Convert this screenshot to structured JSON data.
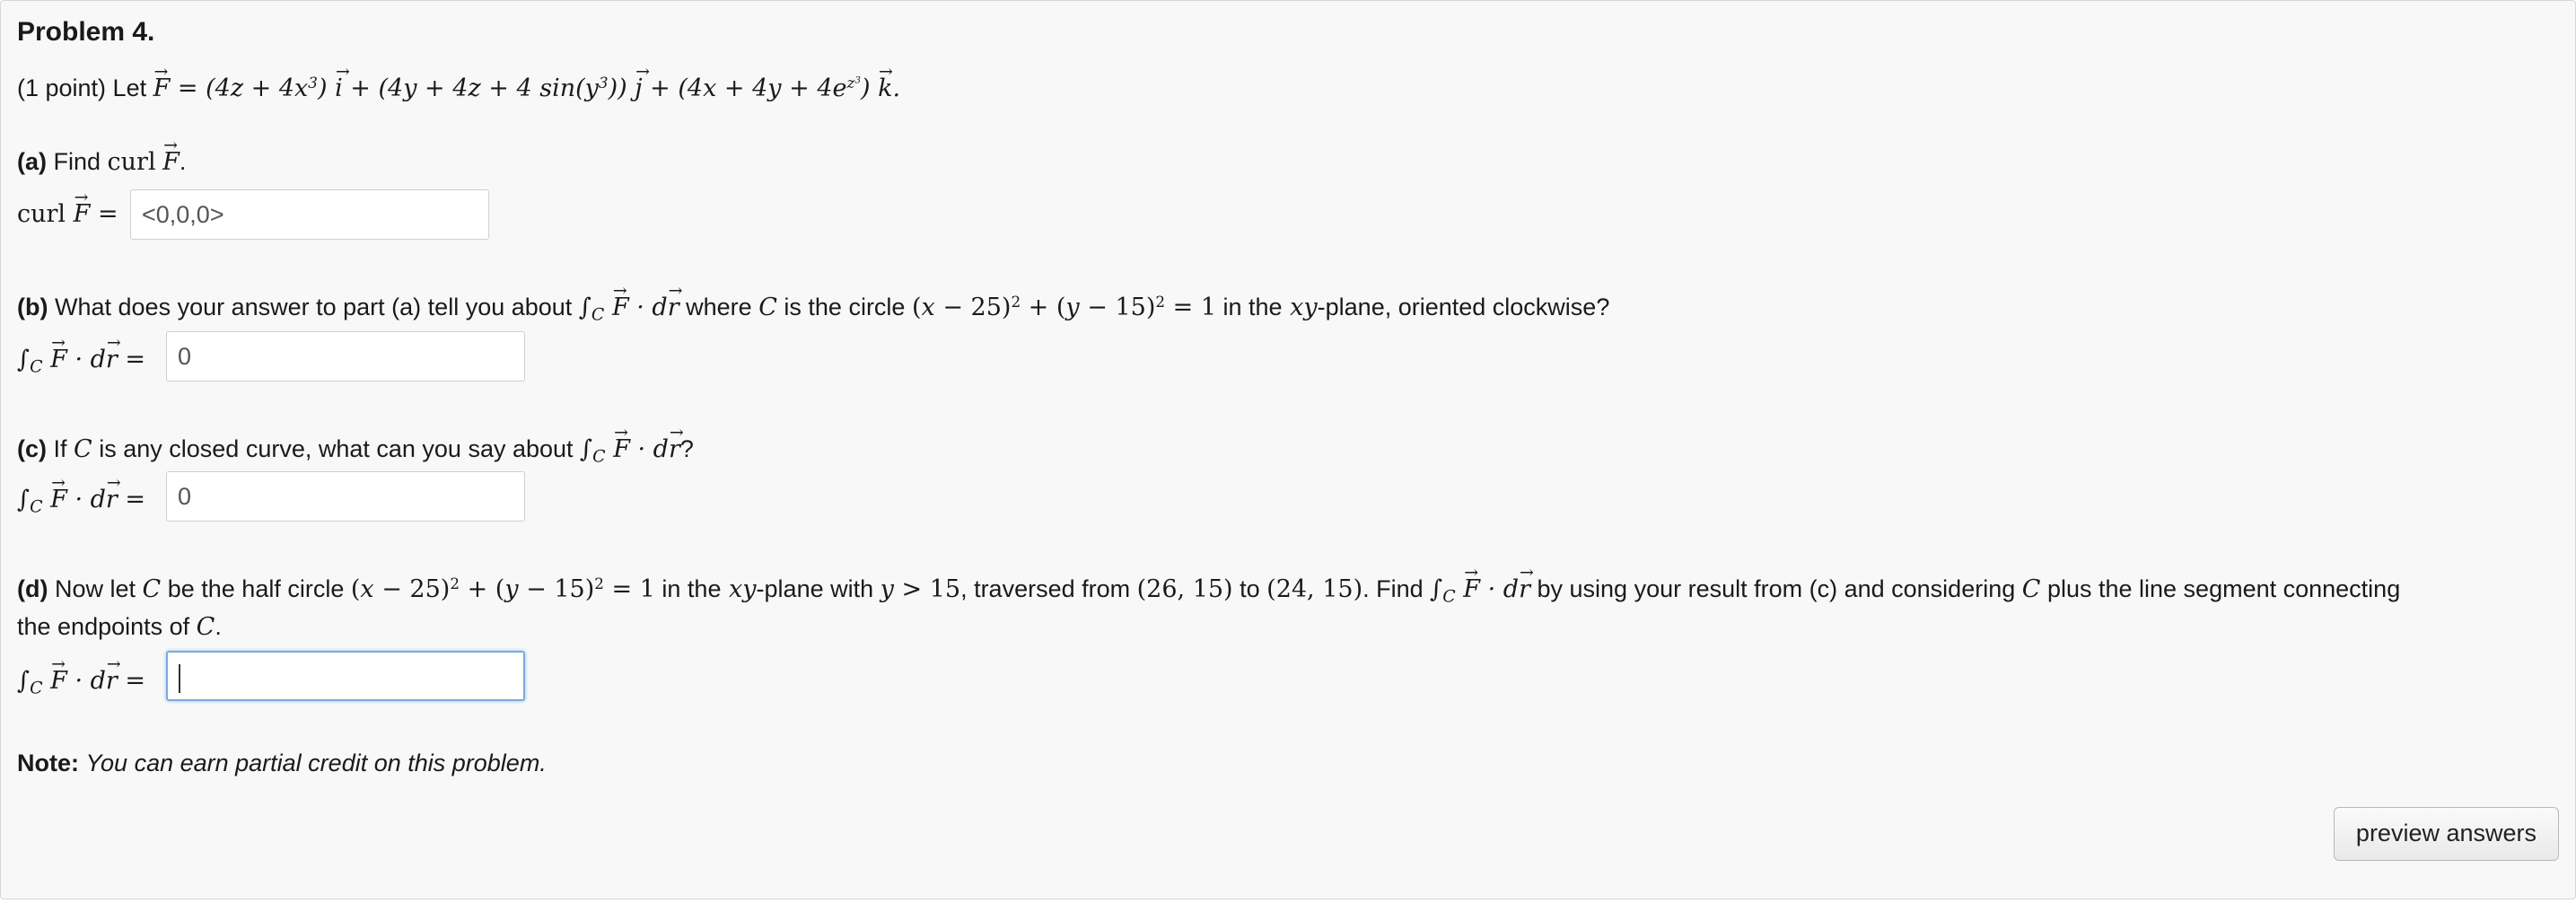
{
  "problem": {
    "title": "Problem 4.",
    "intro_prefix": "(1 point) Let",
    "field_math": "= (4z + 4x³) i + (4y + 4z + 4 sin(y³)) j + (4x + 4y + 4e^{z³}) k."
  },
  "part_a": {
    "label": "(a)",
    "prompt": "Find curl F.",
    "lhs": "curl F =",
    "answer_value": "<0,0,0>"
  },
  "part_b": {
    "label": "(b)",
    "prompt_1": "What does your answer to part (a) tell you about",
    "prompt_2": "where",
    "prompt_3": "is the circle",
    "prompt_4": "in the",
    "prompt_5": "-plane, oriented clockwise?",
    "answer_value": "0"
  },
  "part_c": {
    "label": "(c)",
    "prompt_1": "If",
    "prompt_2": "is any closed curve, what can you say about",
    "answer_value": "0"
  },
  "part_d": {
    "label": "(d)",
    "prompt_1": "Now let",
    "prompt_2": "be the half circle",
    "prompt_3": "in the",
    "prompt_4": "-plane with",
    "prompt_5": ", traversed from",
    "prompt_6": "to",
    "prompt_7": ". Find",
    "prompt_8": "by using your result from (c) and considering",
    "prompt_9": "plus the line segment connecting",
    "prompt_10": "the endpoints of",
    "answer_value": ""
  },
  "note": {
    "label": "Note:",
    "text": "You can earn partial credit on this problem."
  },
  "buttons": {
    "preview_label": "preview answers"
  }
}
